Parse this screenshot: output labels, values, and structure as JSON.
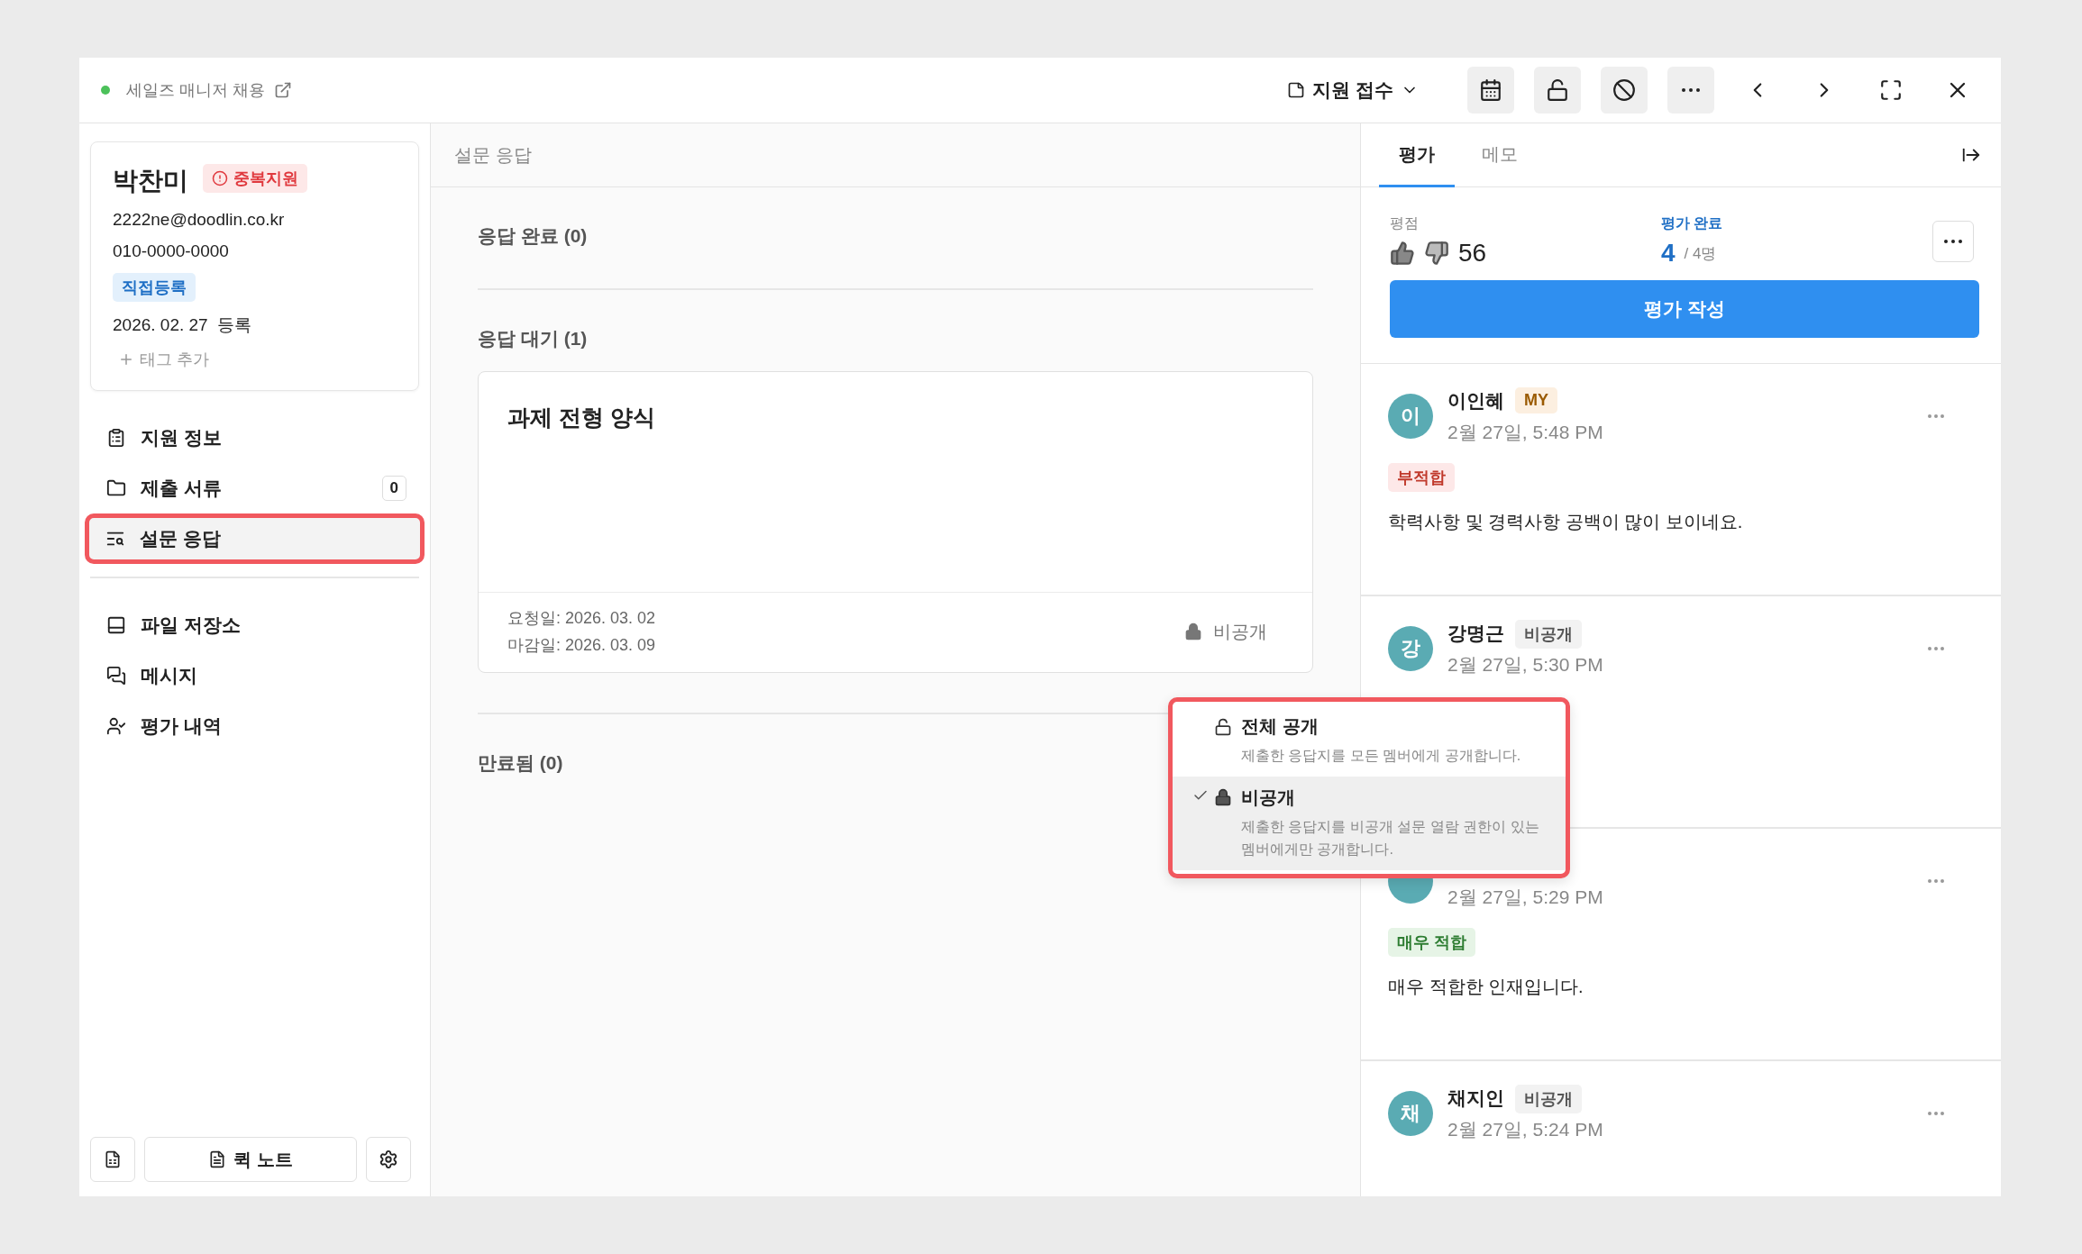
{
  "header": {
    "job_title": "세일즈 매니저 채용",
    "status": "지원 접수"
  },
  "candidate": {
    "name": "박찬미",
    "duplicate_badge": "중복지원",
    "email": "2222ne@doodlin.co.kr",
    "phone": "010-0000-0000",
    "source_tag": "직접등록",
    "registered": "2026. 02. 27  등록",
    "add_tag": "태그 추가"
  },
  "nav_groups": [
    [
      {
        "kind": "info",
        "label": "지원 정보",
        "selected": false
      },
      {
        "kind": "documents",
        "label": "제출 서류",
        "count": "0",
        "selected": false
      },
      {
        "kind": "survey",
        "label": "설문 응답",
        "selected": true
      }
    ],
    [
      {
        "kind": "storage",
        "label": "파일 저장소",
        "selected": false
      },
      {
        "kind": "message",
        "label": "메시지",
        "selected": false
      },
      {
        "kind": "review",
        "label": "평가 내역",
        "selected": false
      }
    ]
  ],
  "footer": {
    "quick_note": "퀵 노트"
  },
  "survey": {
    "title": "설문 응답",
    "sections": [
      {
        "heading": "응답 완료 (0)"
      },
      {
        "heading": "응답 대기 (1)",
        "cards": [
          {
            "title": "과제 전형 양식",
            "requested": "요청일: 2026. 03. 02",
            "deadline": "마감일: 2026. 03. 09",
            "visibility": "비공개"
          }
        ]
      },
      {
        "heading": "만료됨 (0)"
      }
    ]
  },
  "visibility_menu": {
    "options": [
      {
        "kind": "public",
        "title": "전체 공개",
        "description": "제출한 응답지를 모든 멤버에게 공개합니다.",
        "selected": false
      },
      {
        "kind": "private",
        "title": "비공개",
        "description": "제출한 응답지를 비공개 설문 열람 권한이 있는 멤버에게만 공개합니다.",
        "selected": true
      }
    ]
  },
  "review": {
    "tabs": [
      {
        "label": "평가",
        "selected": true
      },
      {
        "label": "메모",
        "selected": false
      }
    ],
    "score_label": "평점",
    "score": "56",
    "done_label": "평가 완료",
    "done_count": "4",
    "done_total": "/ 4명",
    "write_button": "평가 작성",
    "entries": [
      {
        "avatar": "이",
        "name": "이인혜",
        "badge": {
          "kind": "my",
          "text": "MY"
        },
        "time": "2월 27일, 5:48 PM",
        "verdict": {
          "kind": "negative",
          "text": "부적합"
        },
        "comment": "학력사항 및 경력사항 공백이 많이 보이네요."
      },
      {
        "avatar": "강",
        "name": "강명근",
        "badge": {
          "kind": "private",
          "text": "비공개"
        },
        "time": "2월 27일, 5:30 PM"
      },
      {
        "time": "2월 27일, 5:29 PM",
        "verdict": {
          "kind": "positive",
          "text": "매우 적합"
        },
        "comment": "매우 적합한 인재입니다."
      },
      {
        "avatar": "채",
        "name": "채지인",
        "badge": {
          "kind": "private",
          "text": "비공개"
        },
        "time": "2월 27일, 5:24 PM"
      }
    ]
  }
}
